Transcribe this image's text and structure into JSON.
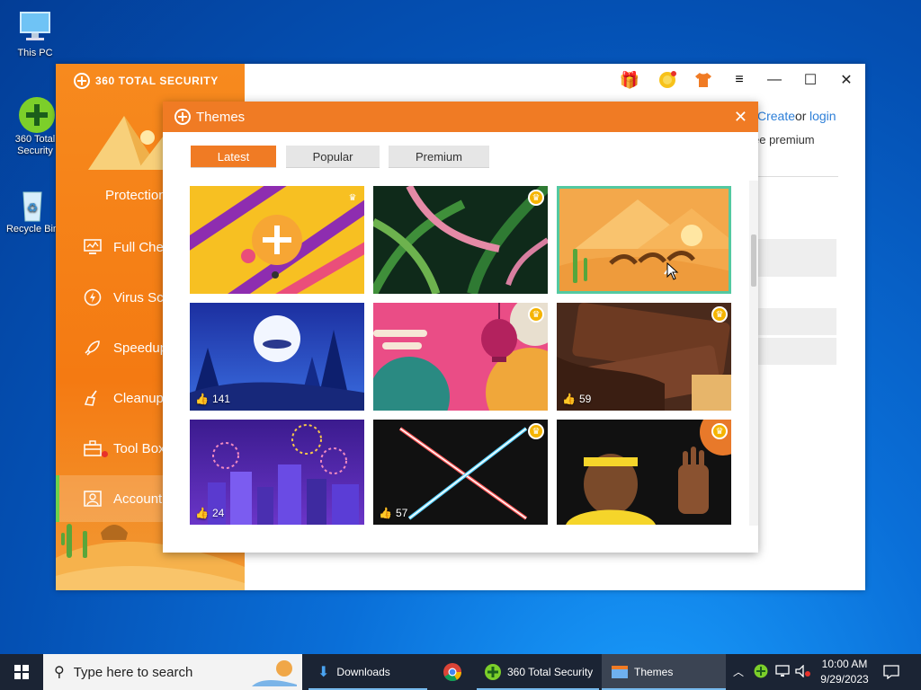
{
  "desktop": {
    "icons": [
      {
        "label": "This PC"
      },
      {
        "label": "360 Total Security"
      },
      {
        "label": "Recycle Bin"
      }
    ]
  },
  "app": {
    "brand": "360 TOTAL SECURITY",
    "protection_label": "Protection",
    "nav": [
      {
        "label": "Full Check",
        "icon": "monitor-icon"
      },
      {
        "label": "Virus Scan",
        "icon": "lightning-icon"
      },
      {
        "label": "Speedup",
        "icon": "rocket-icon"
      },
      {
        "label": "Cleanup",
        "icon": "broom-icon"
      },
      {
        "label": "Tool Box",
        "icon": "toolbox-icon"
      },
      {
        "label": "Account",
        "icon": "account-icon"
      }
    ],
    "right_panel": {
      "create": "Create",
      "or": "or",
      "login": "login",
      "premium_text": "ee premium"
    }
  },
  "dialog": {
    "title": "Themes",
    "tabs": [
      "Latest",
      "Popular",
      "Premium"
    ],
    "active_tab": "Latest",
    "themes": [
      {
        "premium": true
      },
      {
        "premium": true
      },
      {
        "premium": false,
        "selected": true
      },
      {
        "premium": false,
        "likes": "141"
      },
      {
        "premium": true
      },
      {
        "premium": true,
        "likes": "59"
      },
      {
        "premium": false,
        "likes": "24"
      },
      {
        "premium": true,
        "likes": "57"
      },
      {
        "premium": true
      }
    ]
  },
  "taskbar": {
    "search_placeholder": "Type here to search",
    "items": [
      "Downloads",
      "360 Total Security",
      "Themes"
    ],
    "time": "10:00 AM",
    "date": "9/29/2023"
  },
  "colors": {
    "accent": "#f07b24",
    "selected_border": "#53c9a1"
  }
}
